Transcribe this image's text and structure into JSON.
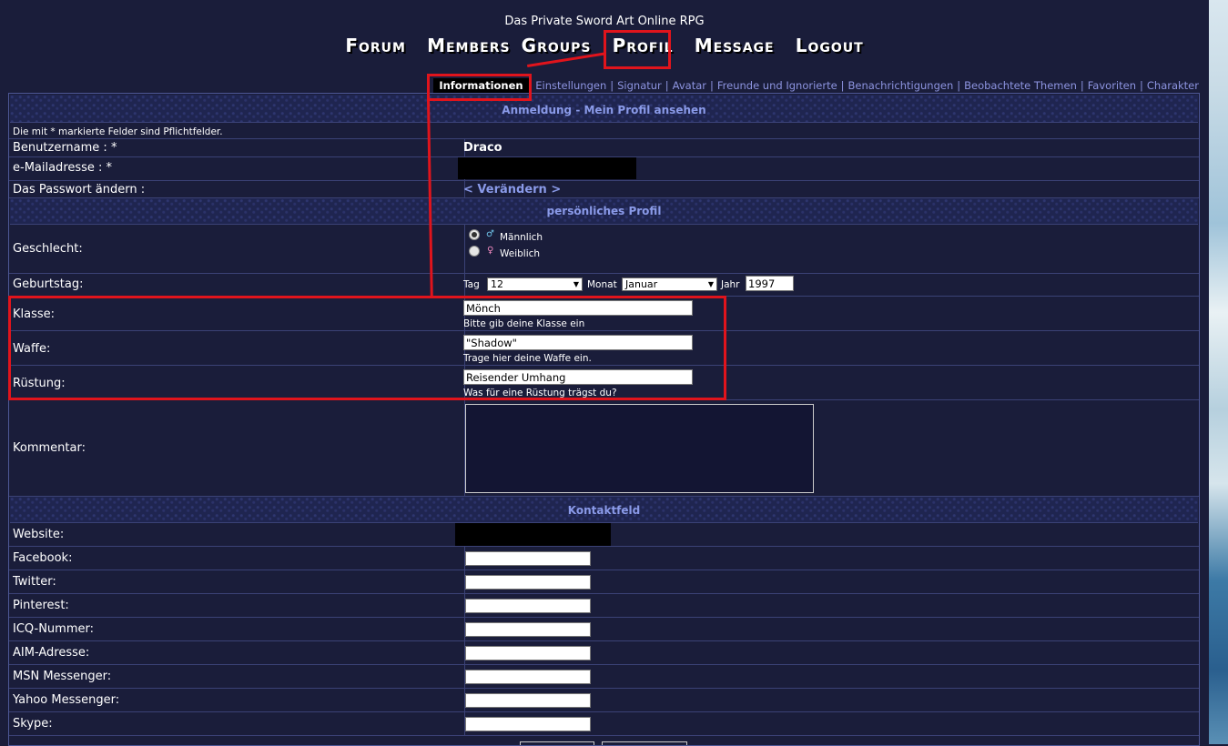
{
  "site_title": "Das Private Sword Art Online RPG",
  "main_nav": [
    "Forum",
    "Members",
    "Groups",
    "Profil",
    "Message",
    "Logout"
  ],
  "sub_nav": [
    "Informationen",
    "Einstellungen",
    "Signatur",
    "Avatar",
    "Freunde und Ignorierte",
    "Benachrichtigungen",
    "Beobachtete Themen",
    "Favoriten",
    "Charakter"
  ],
  "section_login": "Anmeldung - Mein Profil ansehen",
  "required_note": "Die mit * markierte Felder sind Pflichtfelder.",
  "username_label": "Benutzername : *",
  "username_value": "Draco",
  "email_label": "e-Mailadresse : *",
  "password_label": "Das Passwort ändern :",
  "password_link": "< Verändern >",
  "section_personal": "persönliches Profil",
  "gender_label": "Geschlecht:",
  "gender_male": "Männlich",
  "gender_female": "Weiblich",
  "birthday_label": "Geburtstag:",
  "birthday": {
    "day_label": "Tag",
    "day": "12",
    "month_label": "Monat",
    "month": "Januar",
    "year_label": "Jahr",
    "year": "1997"
  },
  "class_label": "Klasse:",
  "class_value": "Mönch",
  "class_hint": "Bitte gib deine Klasse ein",
  "weapon_label": "Waffe:",
  "weapon_value": "\"Shadow\"",
  "weapon_hint": "Trage hier deine Waffe ein.",
  "armor_label": "Rüstung:",
  "armor_value": "Reisender Umhang",
  "armor_hint": "Was für eine Rüstung trägst du?",
  "comment_label": "Kommentar:",
  "section_contact": "Kontaktfeld",
  "contacts": [
    "Website:",
    "Facebook:",
    "Twitter:",
    "Pinterest:",
    "ICQ-Nummer:",
    "AIM-Adresse:",
    "MSN Messenger:",
    "Yahoo Messenger:",
    "Skype:"
  ],
  "colors": {
    "background": "#1a1d3a",
    "header_text": "#8a9ae8",
    "link": "#8d94e0",
    "annotation": "#e0141c"
  }
}
